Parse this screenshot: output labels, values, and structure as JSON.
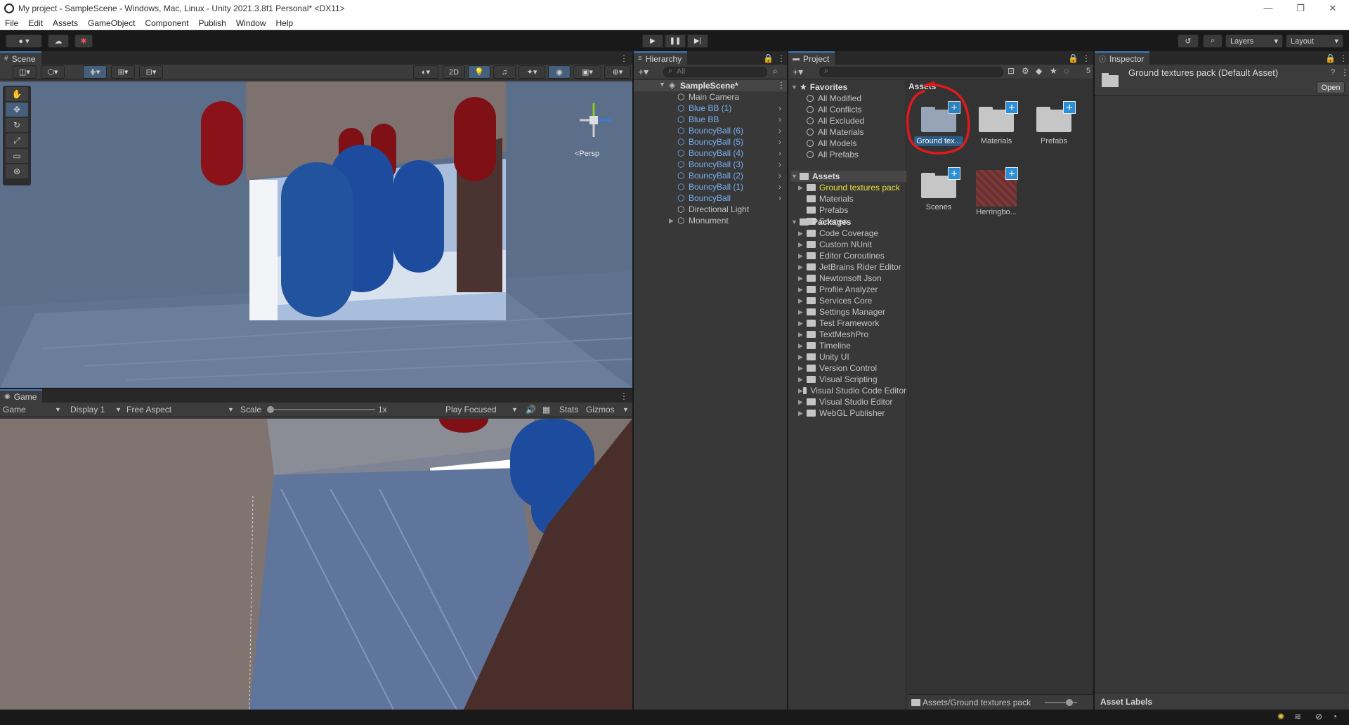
{
  "window": {
    "title": "My project - SampleScene - Windows, Mac, Linux - Unity 2021.3.8f1 Personal* <DX11>",
    "minimize": "—",
    "maximize": "❐",
    "close": "✕"
  },
  "menu": [
    "File",
    "Edit",
    "Assets",
    "GameObject",
    "Component",
    "Publish",
    "Window",
    "Help"
  ],
  "toolbar": {
    "layers_label": "Layers",
    "layout_label": "Layout",
    "play_icon": "▶",
    "pause_icon": "❚❚",
    "step_icon": "▶|"
  },
  "scene": {
    "tab_label": "Scene",
    "mode_2d": "2D",
    "persp_label": "<Persp"
  },
  "game": {
    "tab_label": "Game",
    "mode_dropdown": "Game",
    "display_dropdown": "Display 1",
    "aspect_dropdown": "Free Aspect",
    "scale_label": "Scale",
    "scale_value": "1x",
    "play_focused": "Play Focused",
    "stats_label": "Stats",
    "gizmos_label": "Gizmos"
  },
  "hierarchy": {
    "tab_label": "Hierarchy",
    "search_placeholder": "All",
    "scene_name": "SampleScene*",
    "items": [
      {
        "label": "Main Camera",
        "color": "#c4c4c4",
        "expandable": false
      },
      {
        "label": "Blue BB (1)",
        "color": "#7ab0f2",
        "expandable": true
      },
      {
        "label": "Blue BB",
        "color": "#7ab0f2",
        "expandable": true
      },
      {
        "label": "BouncyBall (6)",
        "color": "#7ab0f2",
        "expandable": true
      },
      {
        "label": "BouncyBall (5)",
        "color": "#7ab0f2",
        "expandable": true
      },
      {
        "label": "BouncyBall (4)",
        "color": "#7ab0f2",
        "expandable": true
      },
      {
        "label": "BouncyBall (3)",
        "color": "#7ab0f2",
        "expandable": true
      },
      {
        "label": "BouncyBall (2)",
        "color": "#7ab0f2",
        "expandable": true
      },
      {
        "label": "BouncyBall (1)",
        "color": "#7ab0f2",
        "expandable": true
      },
      {
        "label": "BouncyBall",
        "color": "#7ab0f2",
        "expandable": true
      },
      {
        "label": "Directional Light",
        "color": "#c4c4c4",
        "expandable": false
      },
      {
        "label": "Monument",
        "color": "#c4c4c4",
        "expandable": false
      }
    ]
  },
  "project": {
    "tab_label": "Project",
    "hidden_count": "5",
    "favorites_label": "Favorites",
    "favorites": [
      "All Modified",
      "All Conflicts",
      "All Excluded",
      "All Materials",
      "All Models",
      "All Prefabs"
    ],
    "assets_label": "Assets",
    "assets_children": [
      "Ground textures pack",
      "Materials",
      "Prefabs",
      "Scenes"
    ],
    "packages_label": "Packages",
    "packages": [
      "Code Coverage",
      "Custom NUnit",
      "Editor Coroutines",
      "JetBrains Rider Editor",
      "Newtonsoft Json",
      "Profile Analyzer",
      "Services Core",
      "Settings Manager",
      "Test Framework",
      "TextMeshPro",
      "Timeline",
      "Unity UI",
      "Version Control",
      "Visual Scripting",
      "Visual Studio Code Editor",
      "Visual Studio Editor",
      "WebGL Publisher"
    ],
    "grid_header": "Assets",
    "grid_items": [
      "Ground tex...",
      "Materials",
      "Prefabs",
      "Scenes",
      "Herringbo..."
    ],
    "footer_path": "Assets/Ground textures pack"
  },
  "inspector": {
    "tab_label": "Inspector",
    "asset_title": "Ground textures pack (Default Asset)",
    "open_button": "Open",
    "asset_labels": "Asset Labels"
  },
  "colors": {
    "accent": "#3a79bb",
    "selection": "#2c5d87",
    "highlight_circle": "#e0191e",
    "prefab_blue": "#7ab0f2",
    "modified_yellow": "#e8e23a"
  }
}
